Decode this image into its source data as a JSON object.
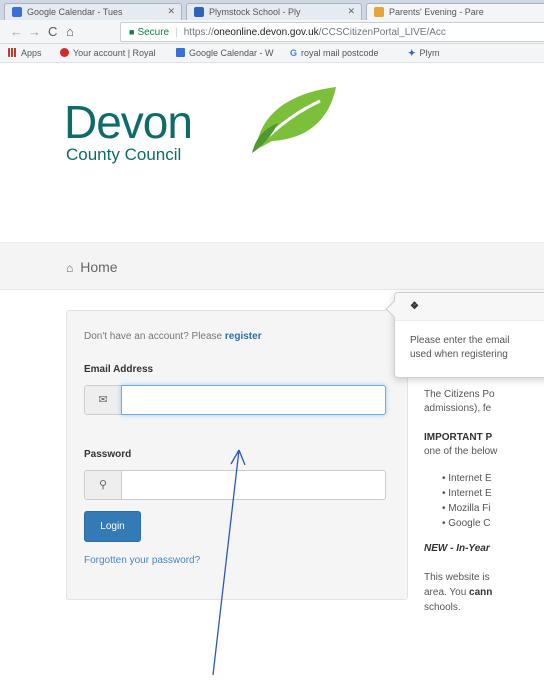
{
  "browser": {
    "tabs": [
      {
        "label": "Google Calendar - Tues",
        "icon_color": "#3b6fd6"
      },
      {
        "label": "Plymstock School - Ply",
        "icon_color": "#2e64b8"
      },
      {
        "label": "Parents' Evening - Pare",
        "icon_color": "#e8a33c"
      }
    ],
    "address": {
      "secure_label": "Secure",
      "scheme": "https://",
      "domain": "oneonline.devon.gov.uk",
      "path": "/CCSCitizenPortal_LIVE/Acc"
    },
    "bookmarks": [
      {
        "label": "Apps",
        "icon": "apps-grid-icon",
        "color": "#c0392b"
      },
      {
        "label": "Your account | Royal",
        "icon": "royal-mail-icon",
        "color": "#d12b2b"
      },
      {
        "label": "Google Calendar - W",
        "icon": "calendar-icon",
        "color": "#3b6fd6"
      },
      {
        "label": "royal mail postcode",
        "icon": "google-g-icon",
        "color": "#4285f4"
      },
      {
        "label": "Plym",
        "icon": "school-icon",
        "color": "#2e64b8"
      }
    ]
  },
  "logo": {
    "word": "Devon",
    "sub": "County Council",
    "brand_color": "#0f6a6a",
    "leaf_colors": [
      "#7cbf3a",
      "#4f9a2e"
    ]
  },
  "breadcrumb": {
    "home_label": "Home"
  },
  "login": {
    "register_prompt": "Don't have an account? Please ",
    "register_link": "register",
    "email_label": "Email Address",
    "email_value": "",
    "password_label": "Password",
    "password_value": "",
    "login_button": "Login",
    "forgot_link": "Forgotten your password?"
  },
  "popover": {
    "line1": "Please enter the email",
    "line2": "used when registering"
  },
  "info": {
    "para1_line1": "The Citizens Po",
    "para1_line2": "admissions), fe",
    "important_label": "IMPORTANT P",
    "important_line2": "one of the below",
    "browsers": [
      "Internet E",
      "Internet E",
      "Mozilla Fi",
      "Google C"
    ],
    "new_label": "NEW - In-Year",
    "para3_line1": "This website is",
    "para3_line2a": "area. You ",
    "para3_line2b": "cann",
    "para3_line3": "schools."
  },
  "colors": {
    "accent": "#337ab7",
    "link": "#2a6eb0"
  }
}
